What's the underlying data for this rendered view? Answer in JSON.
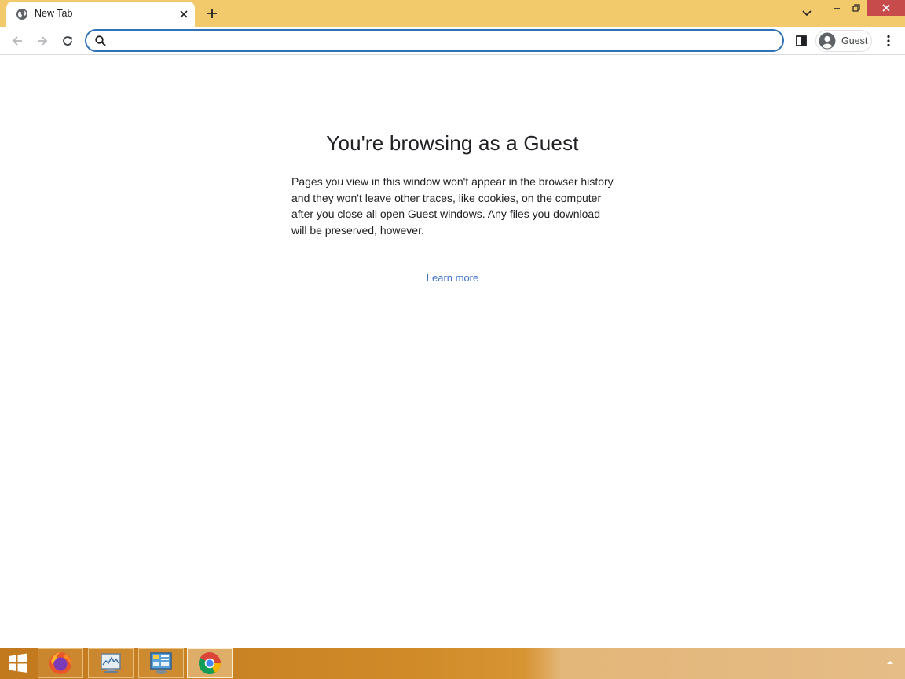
{
  "tab": {
    "title": "New Tab",
    "favicon": "globe-icon"
  },
  "window_controls": [
    "minimize-icon",
    "restore-icon",
    "close-icon"
  ],
  "toolbar": {
    "back_icon": "arrow-left-icon",
    "forward_icon": "arrow-right-icon",
    "reload_icon": "reload-icon",
    "omnibox": {
      "icon": "search-icon",
      "value": "",
      "placeholder": ""
    },
    "side_panel_icon": "side-panel-icon",
    "profile": {
      "label": "Guest",
      "icon": "account-circle-icon"
    },
    "menu_icon": "kebab-menu-icon"
  },
  "content": {
    "title": "You're browsing as a Guest",
    "description": "Pages you view in this window won't appear in the browser history and they won't leave other traces, like cookies, on the computer after you close all open Guest windows. Any files you download will be preserved, however.",
    "learn_more": "Learn more"
  },
  "taskbar": {
    "apps": [
      "firefox-icon",
      "system-monitor-icon",
      "control-panel-icon",
      "chrome-icon"
    ]
  },
  "colors": {
    "titlebar": "#f2c96b",
    "omnibox_border": "#2f72b9",
    "link": "#3f72c8",
    "close_button": "#c74b4b"
  }
}
